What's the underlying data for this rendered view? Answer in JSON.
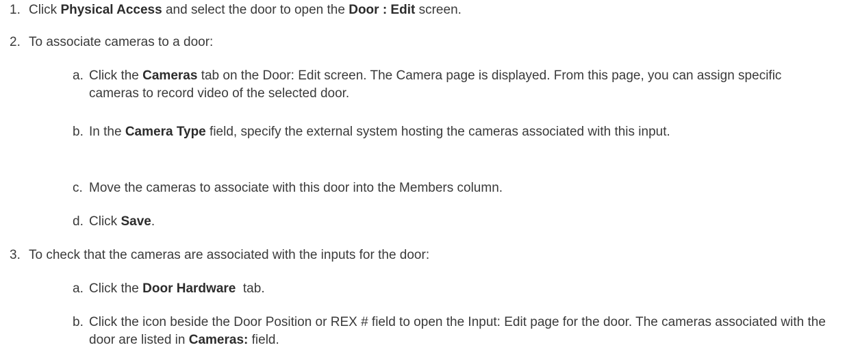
{
  "steps": [
    {
      "num": "1.",
      "parts": [
        "Click ",
        "Physical Access",
        " and select the door to open the ",
        "Door : Edit",
        " screen."
      ]
    },
    {
      "num": "2.",
      "text": "To associate cameras to a door:",
      "subs": [
        {
          "letter": "a.",
          "parts": [
            "Click the ",
            "Cameras",
            " tab on the Door: Edit screen. The Camera page is displayed. From this page, you can assign specific cameras to record video of the selected door."
          ]
        },
        {
          "letter": "b.",
          "parts": [
            "In the ",
            "Camera Type",
            " field, specify the external system hosting the cameras associated with this input."
          ]
        },
        {
          "letter": "c.",
          "text": "Move the cameras to associate with this door into the Members column."
        },
        {
          "letter": "d.",
          "parts": [
            "Click ",
            "Save",
            "."
          ]
        }
      ]
    },
    {
      "num": "3.",
      "text": "To check that the cameras are associated with the inputs for the door:",
      "subs": [
        {
          "letter": "a.",
          "parts": [
            "Click the ",
            "Door Hardware",
            "  tab."
          ]
        },
        {
          "letter": "b.",
          "parts": [
            "Click the  icon beside the Door Position or REX # field to open the Input: Edit page for the door. The cameras associated with the door are listed in ",
            "Cameras:",
            " field."
          ]
        }
      ]
    }
  ]
}
